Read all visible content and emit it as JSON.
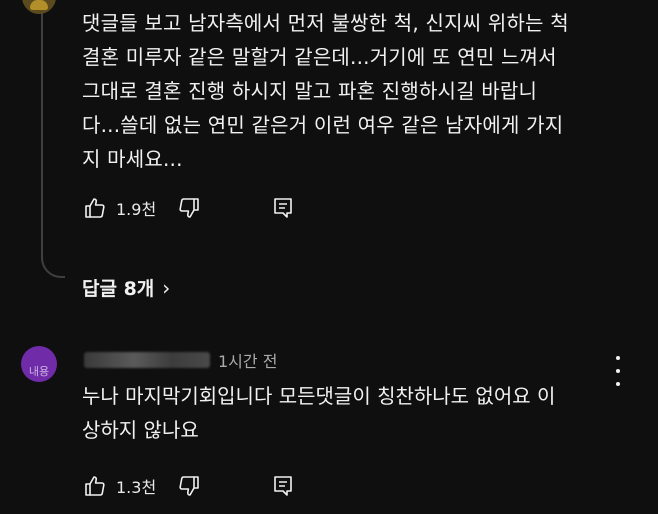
{
  "comment1": {
    "text": "댓글들 보고 남자측에서 먼저 불쌍한 척, 신지씨 위하는 척\n결혼 미루자 같은 말할거 같은데...거기에 또 연민 느껴서\n그대로 결혼 진행 하시지 말고 파혼 진행하시길 바랍니\n다...쓸데 없는 연민 같은거 이런 여우 같은 남자에게 가지\n지 마세요...",
    "likes": "1.9천",
    "like_icon": "thumb-up-icon",
    "dislike_icon": "thumb-down-icon",
    "reply_icon": "reply-icon",
    "replies_label": "답글 8개",
    "replies_chevron": "›"
  },
  "comment2": {
    "timestamp": "1시간 전",
    "text": "누나 마지막기회입니다 모든댓글이 칭찬하나도 없어요 이\n상하지 않나요",
    "likes": "1.3천",
    "avatar_color": "#6f2ba8",
    "menu_icon": "more-vert-icon"
  },
  "colors": {
    "background": "#0f0f0f",
    "text": "#f1f1f1",
    "secondary_text": "#aaaaaa"
  }
}
